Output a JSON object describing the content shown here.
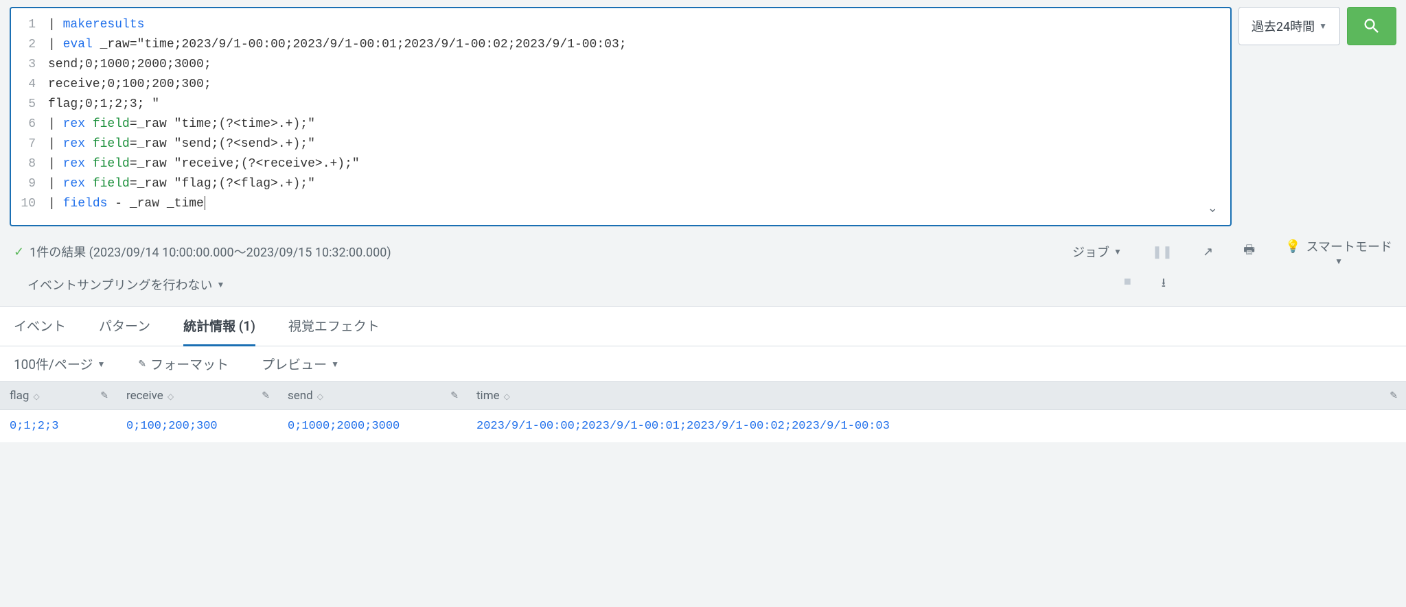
{
  "search": {
    "lines": [
      {
        "num": "1",
        "segments": [
          {
            "cls": "tk-pipe",
            "t": "| "
          },
          {
            "cls": "tk-cmd",
            "t": "makeresults"
          }
        ]
      },
      {
        "num": "2",
        "segments": [
          {
            "cls": "tk-pipe",
            "t": "| "
          },
          {
            "cls": "tk-cmd",
            "t": "eval"
          },
          {
            "cls": "tk-plain",
            "t": " _raw="
          },
          {
            "cls": "tk-str",
            "t": "\"time;2023/9/1-00:00;2023/9/1-00:01;2023/9/1-00:02;2023/9/1-00:03;"
          }
        ]
      },
      {
        "num": "3",
        "segments": [
          {
            "cls": "tk-str",
            "t": "send;0;1000;2000;3000;"
          }
        ]
      },
      {
        "num": "4",
        "segments": [
          {
            "cls": "tk-str",
            "t": "receive;0;100;200;300;"
          }
        ]
      },
      {
        "num": "5",
        "segments": [
          {
            "cls": "tk-str",
            "t": "flag;0;1;2;3; \""
          }
        ]
      },
      {
        "num": "6",
        "segments": [
          {
            "cls": "tk-pipe",
            "t": "| "
          },
          {
            "cls": "tk-cmd",
            "t": "rex"
          },
          {
            "cls": "tk-plain",
            "t": " "
          },
          {
            "cls": "tk-arg",
            "t": "field"
          },
          {
            "cls": "tk-plain",
            "t": "=_raw "
          },
          {
            "cls": "tk-str",
            "t": "\"time;(?<time>.+);\""
          }
        ]
      },
      {
        "num": "7",
        "segments": [
          {
            "cls": "tk-pipe",
            "t": "| "
          },
          {
            "cls": "tk-cmd",
            "t": "rex"
          },
          {
            "cls": "tk-plain",
            "t": " "
          },
          {
            "cls": "tk-arg",
            "t": "field"
          },
          {
            "cls": "tk-plain",
            "t": "=_raw "
          },
          {
            "cls": "tk-str",
            "t": "\"send;(?<send>.+);\""
          }
        ]
      },
      {
        "num": "8",
        "segments": [
          {
            "cls": "tk-pipe",
            "t": "| "
          },
          {
            "cls": "tk-cmd",
            "t": "rex"
          },
          {
            "cls": "tk-plain",
            "t": " "
          },
          {
            "cls": "tk-arg",
            "t": "field"
          },
          {
            "cls": "tk-plain",
            "t": "=_raw "
          },
          {
            "cls": "tk-str",
            "t": "\"receive;(?<receive>.+);\""
          }
        ]
      },
      {
        "num": "9",
        "segments": [
          {
            "cls": "tk-pipe",
            "t": "| "
          },
          {
            "cls": "tk-cmd",
            "t": "rex"
          },
          {
            "cls": "tk-plain",
            "t": " "
          },
          {
            "cls": "tk-arg",
            "t": "field"
          },
          {
            "cls": "tk-plain",
            "t": "=_raw "
          },
          {
            "cls": "tk-str",
            "t": "\"flag;(?<flag>.+);\""
          }
        ]
      },
      {
        "num": "10",
        "segments": [
          {
            "cls": "tk-pipe",
            "t": "| "
          },
          {
            "cls": "tk-cmd",
            "t": "fields"
          },
          {
            "cls": "tk-plain",
            "t": " - _raw _time"
          }
        ],
        "cursor": true
      }
    ]
  },
  "time_picker": {
    "label": "過去24時間"
  },
  "status": {
    "text": "1件の結果 (2023/09/14 10:00:00.000～2023/09/15 10:32:00.000)",
    "job_label": "ジョブ",
    "smart_mode": "スマートモード"
  },
  "sampling": {
    "label": "イベントサンプリングを行わない"
  },
  "tabs": {
    "events": "イベント",
    "patterns": "パターン",
    "stats": "統計情報 (1)",
    "viz": "視覚エフェクト"
  },
  "toolbar": {
    "per_page": "100件/ページ",
    "format": "フォーマット",
    "preview": "プレビュー"
  },
  "table": {
    "headers": {
      "flag": "flag",
      "receive": "receive",
      "send": "send",
      "time": "time"
    },
    "rows": [
      {
        "flag": "0;1;2;3",
        "receive": "0;100;200;300",
        "send": "0;1000;2000;3000",
        "time": "2023/9/1-00:00;2023/9/1-00:01;2023/9/1-00:02;2023/9/1-00:03"
      }
    ]
  }
}
